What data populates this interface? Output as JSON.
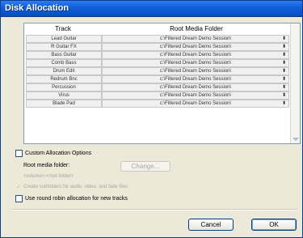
{
  "window": {
    "title": "Disk Allocation"
  },
  "table": {
    "headers": {
      "track": "Track",
      "folder": "Root Media Folder"
    },
    "rows": [
      {
        "track": "Lead Guitar",
        "folder": "c:\\Filtered Dream Demo Session\\"
      },
      {
        "track": "R Guitar FX",
        "folder": "c:\\Filtered Dream Demo Session\\"
      },
      {
        "track": "Bass Guitar",
        "folder": "c:\\Filtered Dream Demo Session\\"
      },
      {
        "track": "Comb Bass",
        "folder": "c:\\Filtered Dream Demo Session\\"
      },
      {
        "track": "Drum Edit",
        "folder": "c:\\Filtered Dream Demo Session\\"
      },
      {
        "track": "Redrum Bnc",
        "folder": "c:\\Filtered Dream Demo Session\\"
      },
      {
        "track": "Percussion",
        "folder": "c:\\Filtered Dream Demo Session\\"
      },
      {
        "track": "Virus",
        "folder": "c:\\Filtered Dream Demo Session\\"
      },
      {
        "track": "Blade Pad",
        "folder": "c:\\Filtered Dream Demo Session\\"
      }
    ],
    "row_arrow_glyph": "⬍"
  },
  "options": {
    "custom_allocation": {
      "label": "Custom Allocation Options",
      "checked": false
    },
    "root_media_folder_label": "Root media folder:",
    "change_button": "Change...",
    "volume_placeholder": "<volume>:<root folder>",
    "create_subfolders": {
      "label": "Create subfolders for audio, video, and fade files",
      "checked": true,
      "disabled": true
    },
    "round_robin": {
      "label": "Use round robin allocation for new tracks",
      "checked": false
    }
  },
  "buttons": {
    "cancel": "Cancel",
    "ok": "OK"
  },
  "colors": {
    "titlebar": "#0f5ed8",
    "dialog_bg": "#ece9d8",
    "cell_bg": "#f0f0f0",
    "disabled_text": "#a9a79a"
  }
}
